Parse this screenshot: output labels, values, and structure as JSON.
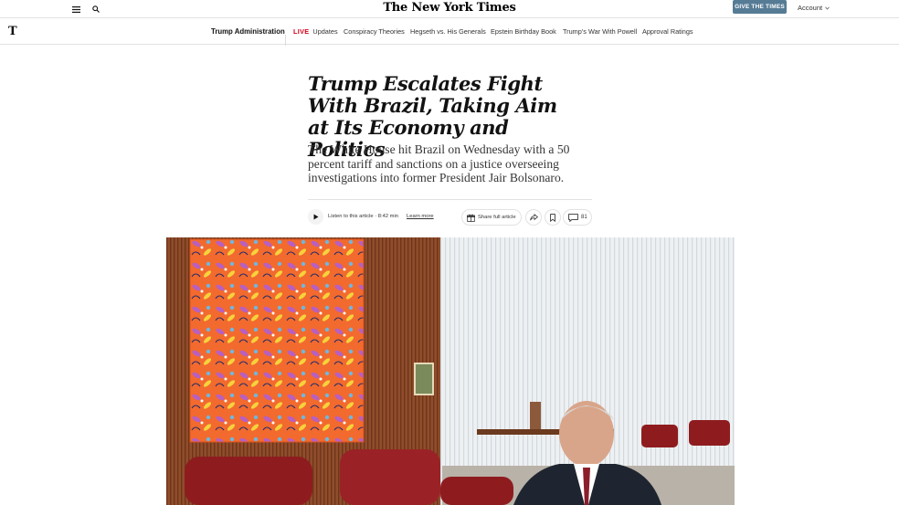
{
  "topbar": {
    "masthead": "The New York Times",
    "give_button": "GIVE THE TIMES",
    "account": "Account",
    "icons": [
      "hamburger-menu-icon",
      "search-icon",
      "chevron-down-icon"
    ]
  },
  "navbar": {
    "logo": "T",
    "section": "Trump Administration",
    "items": [
      {
        "live": "LIVE",
        "label": "Updates"
      },
      {
        "label": "Conspiracy Theories"
      },
      {
        "label": "Hegseth vs. His Generals"
      },
      {
        "label": "Epstein Birthday Book"
      },
      {
        "label": "Trump’s War With Powell"
      },
      {
        "label": "Approval Ratings"
      }
    ]
  },
  "article": {
    "headline": "Trump Escalates Fight With Brazil, Taking Aim at Its Economy and Politics",
    "summary": "The White House hit Brazil on Wednesday with a 50 percent tariff and sanctions on a justice overseeing investigations into former President Jair Bolsonaro.",
    "listen_text": "Listen to this article · 8:42 min",
    "learn_more": "Learn more",
    "share_label": "Share full article",
    "comment_count": "81"
  },
  "colors": {
    "give_button_bg": "#567b95",
    "live_red": "#d0021b",
    "painting_orange": "#f0652d",
    "wood": "#8a4a2a",
    "curtain": "#e8ebee",
    "sofa": "#8e1c1f"
  }
}
